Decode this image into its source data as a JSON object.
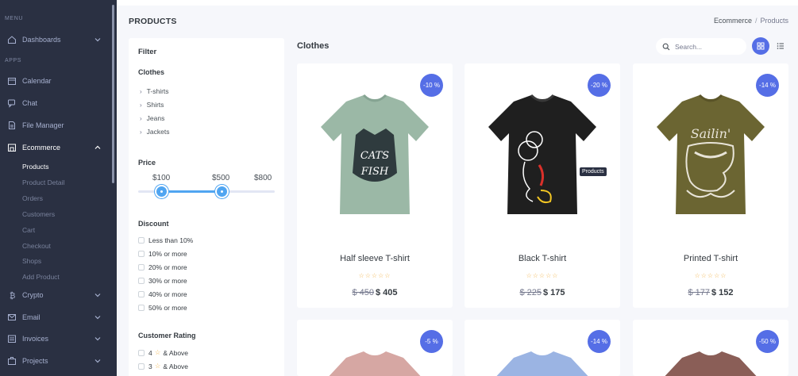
{
  "sidebar": {
    "menu_title": "MENU",
    "apps_title": "APPS",
    "dashboards": "Dashboards",
    "calendar": "Calendar",
    "chat": "Chat",
    "file_manager": "File Manager",
    "ecommerce": "Ecommerce",
    "ecommerce_sub": [
      "Products",
      "Product Detail",
      "Orders",
      "Customers",
      "Cart",
      "Checkout",
      "Shops",
      "Add Product"
    ],
    "crypto": "Crypto",
    "email": "Email",
    "invoices": "Invoices",
    "projects": "Projects"
  },
  "header": {
    "title": "PRODUCTS",
    "breadcrumb_root": "Ecommerce",
    "breadcrumb_sep": "/",
    "breadcrumb_current": "Products"
  },
  "filter": {
    "title": "Filter",
    "clothes_title": "Clothes",
    "categories": [
      "T-shirts",
      "Shirts",
      "Jeans",
      "Jackets"
    ],
    "price_title": "Price",
    "price_min": "$100",
    "price_max": "$500",
    "price_limit": "$800",
    "discount_title": "Discount",
    "discounts": [
      "Less than 10%",
      "10% or more",
      "20% or more",
      "30% or more",
      "40% or more",
      "50% or more"
    ],
    "rating_title": "Customer Rating",
    "ratings": [
      {
        "num": "4",
        "star": "☆",
        "text": "& Above"
      },
      {
        "num": "3",
        "star": "☆",
        "text": "& Above"
      }
    ]
  },
  "main": {
    "section_title": "Clothes",
    "search_placeholder": "Search...",
    "tooltip": "Products",
    "products": [
      {
        "badge": "-10 %",
        "name": "Half sleeve T-shirt",
        "stars": "☆☆☆☆☆",
        "old_price": "$ 450",
        "price": "$ 405",
        "color": "#9bb8a6",
        "print": "#2f3b3e"
      },
      {
        "badge": "-20 %",
        "name": "Black T-shirt",
        "stars": "☆☆☆☆☆",
        "old_price": "$ 225",
        "price": "$ 175",
        "color": "#1f1f1f",
        "print": "#ffffff"
      },
      {
        "badge": "-14 %",
        "name": "Printed T-shirt",
        "stars": "☆☆☆☆☆",
        "old_price": "$ 177",
        "price": "$ 152",
        "color": "#6b6532",
        "print": "#e8e4d8"
      },
      {
        "badge": "-5 %",
        "color": "#d6a7a3"
      },
      {
        "badge": "-14 %",
        "color": "#9bb4e3"
      },
      {
        "badge": "-50 %",
        "color": "#8a5e57"
      }
    ]
  },
  "colors": {
    "sidebar_bg": "#2a3042",
    "accent": "#556ee6",
    "slider": "#50a5f1",
    "star": "#f1b44c"
  }
}
